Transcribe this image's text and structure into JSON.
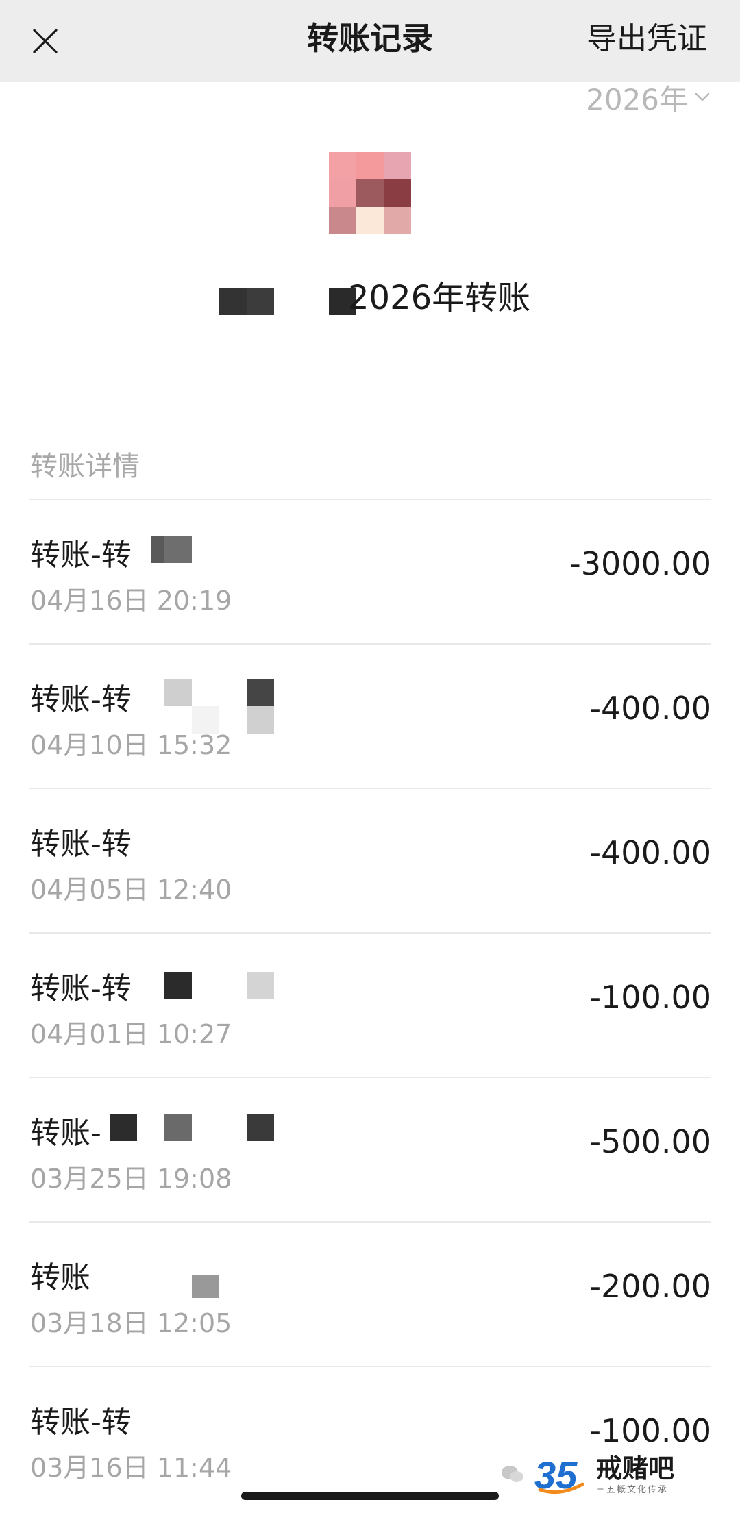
{
  "header": {
    "title": "转账记录",
    "export_label": "导出凭证",
    "close_icon": "close-icon"
  },
  "year_selector": {
    "value": "2026年",
    "icon": "chevron-down-icon"
  },
  "summary": {
    "title": "2026年转账",
    "avatar_colors": [
      "#f4a1a6",
      "#f49a9d",
      "#e6a5b0",
      "#f0a0a4",
      "#9c5a5f",
      "#8a3e44",
      "#c9888c",
      "#fbe8d8",
      "#e1aaa8"
    ]
  },
  "section": {
    "label": "转账详情"
  },
  "transactions": [
    {
      "title": "转账-转",
      "time": "04月16日 20:19",
      "amount": "-3000.00"
    },
    {
      "title": "转账-转",
      "time": "04月10日 15:32",
      "amount": "-400.00"
    },
    {
      "title": "转账-转",
      "time": "04月05日 12:40",
      "amount": "-400.00"
    },
    {
      "title": "转账-转",
      "time": "04月01日 10:27",
      "amount": "-100.00"
    },
    {
      "title": "转账-",
      "time": "03月25日 19:08",
      "amount": "-500.00"
    },
    {
      "title": "转账",
      "time": "03月18日 12:05",
      "amount": "-200.00"
    },
    {
      "title": "转账-转",
      "time": "03月16日 11:44",
      "amount": "-100.00"
    }
  ],
  "watermark": {
    "logo_text": "35",
    "name": "戒赌吧",
    "subtitle": "三五概文化传承",
    "colors": {
      "primary": "#1f6fd1",
      "accent": "#f28a1c"
    }
  }
}
